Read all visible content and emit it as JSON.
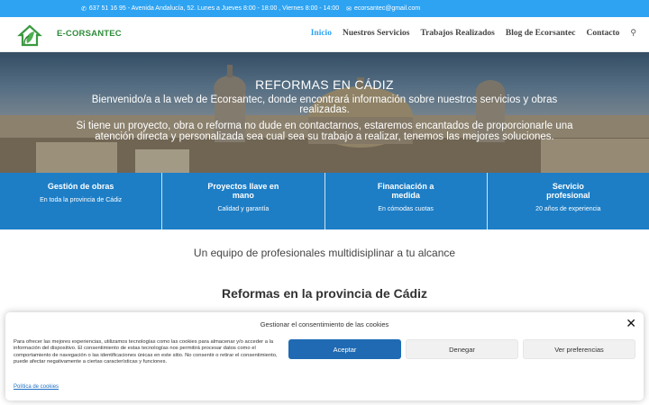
{
  "topbar": {
    "contact_info": "637 51 16 95 - Avenida Andalucía, 52. Lunes a Jueves 8:00 - 18:00 , Viernes 8:00 - 14:00",
    "email": "ecorsantec@gmail.com",
    "phone_icon": "phone-icon",
    "email_icon": "envelope-icon"
  },
  "header": {
    "brand": "E-CORSANTEC",
    "logo_icon": "house-leaf-icon",
    "nav": [
      "Inicio",
      "Nuestros Servicios",
      "Trabajos Realizados",
      "Blog de Ecorsantec",
      "Contacto"
    ],
    "active_index": 0,
    "search_icon": "search-icon"
  },
  "hero": {
    "title": "REFORMAS EN CÁDIZ",
    "paragraph1": "Bienvenido/a a la web de Ecorsantec, donde encontrará información sobre nuestros servicios y obras realizadas.",
    "paragraph2": "Si tiene un proyecto, obra o reforma no dude en contactarnos, estaremos encantados de proporcionarle una atención directa y personalizada sea cual sea su trabajo a realizar, tenemos las mejores soluciones."
  },
  "features": [
    {
      "title": "Gestión de obras",
      "subtitle": "En toda la provincia de Cádiz"
    },
    {
      "title": "Proyectos llave en mano",
      "subtitle": "Calidad y garantía"
    },
    {
      "title": "Financiación a medida",
      "subtitle": "En cómodas cuotas"
    },
    {
      "title": "Servicio profesional",
      "subtitle": "20 años de experiencia"
    }
  ],
  "tagline": "Un equipo de profesionales multidisiplinar a tu alcance",
  "section_heading": "Reformas en la provincia de Cádiz",
  "cookie": {
    "title": "Gestionar el consentimiento de las cookies",
    "body": "Para ofrecer las mejores experiencias, utilizamos tecnologías como las cookies para almacenar y/o acceder a la información del dispositivo. El consentimiento de estas tecnologías nos permitirá procesar datos como el comportamiento de navegación o las identificaciones únicas en este sitio. No consentir o retirar el consentimiento, puede afectar negativamente a ciertas características y funciones.",
    "accept": "Aceptar",
    "deny": "Denegar",
    "preferences": "Ver preferencias",
    "policy_link": "Política de cookies",
    "close_icon": "close-icon"
  },
  "colors": {
    "topbar": "#2ea3f2",
    "features": "#1d7ec6",
    "accept_button": "#1f6ab3",
    "brand": "#2e8b3a"
  }
}
